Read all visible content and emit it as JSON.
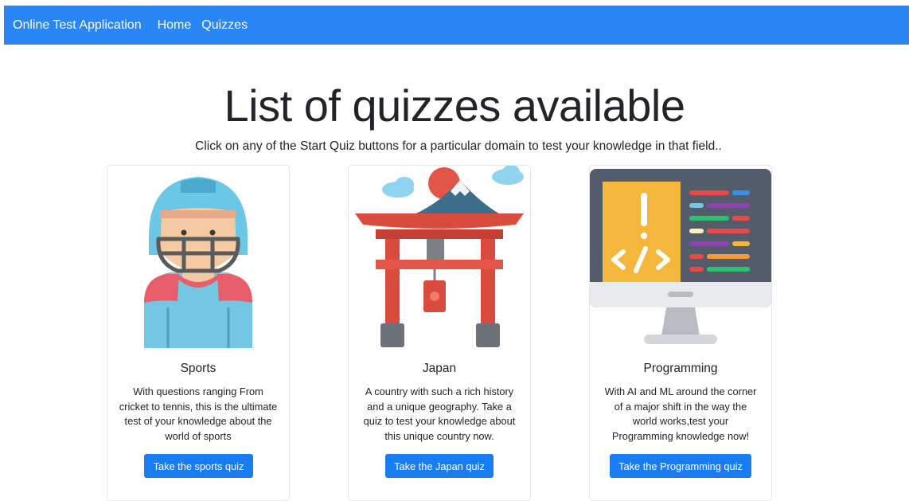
{
  "navbar": {
    "brand": "Online Test Application",
    "links": [
      "Home",
      "Quizzes"
    ],
    "background": "#2b86f5"
  },
  "page": {
    "title": "List of quizzes available",
    "subtitle": "Click on any of the Start Quiz buttons for a particular domain to test your knowledge in that field.."
  },
  "quizzes": [
    {
      "name": "Sports",
      "description": "With questions ranging From cricket to tennis, this is the ultimate test of your knowledge about the world of sports",
      "button": "Take the sports quiz",
      "icon": "football-player-icon"
    },
    {
      "name": "Japan",
      "description": "A country with such a rich history and a unique geography. Take a quiz to test your knowledge about this unique country now.",
      "button": "Take the Japan quiz",
      "icon": "torii-gate-icon"
    },
    {
      "name": "Programming",
      "description": "With AI and ML around the corner of a major shift in the way the world works,test your Programming knowledge now!",
      "button": "Take the Programming quiz",
      "icon": "code-monitor-icon"
    }
  ],
  "colors": {
    "button": "#1a7cf3"
  }
}
